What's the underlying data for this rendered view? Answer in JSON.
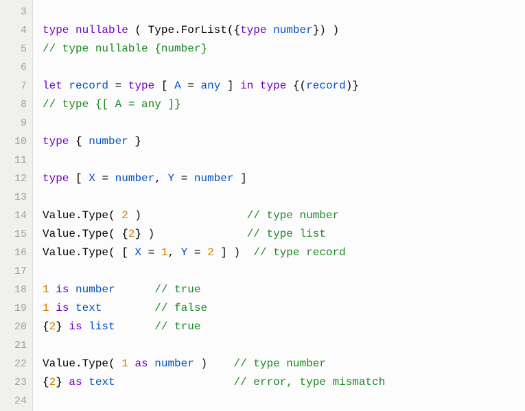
{
  "lineNumbers": [
    "3",
    "4",
    "5",
    "6",
    "7",
    "8",
    "9",
    "10",
    "11",
    "12",
    "13",
    "14",
    "15",
    "16",
    "17",
    "18",
    "19",
    "20",
    "21",
    "22",
    "23",
    "24"
  ],
  "lines": {
    "3": [],
    "4": [
      {
        "cls": "kw-type",
        "t": "type"
      },
      {
        "cls": "op",
        "t": " "
      },
      {
        "cls": "kw-type",
        "t": "nullable"
      },
      {
        "cls": "op",
        "t": " ( "
      },
      {
        "cls": "func",
        "t": "Type.ForList"
      },
      {
        "cls": "op",
        "t": "({"
      },
      {
        "cls": "kw-type",
        "t": "type"
      },
      {
        "cls": "op",
        "t": " "
      },
      {
        "cls": "kw-id",
        "t": "number"
      },
      {
        "cls": "op",
        "t": "}) )"
      }
    ],
    "5": [
      {
        "cls": "comment",
        "t": "// type nullable {number}"
      }
    ],
    "6": [],
    "7": [
      {
        "cls": "kw-type",
        "t": "let"
      },
      {
        "cls": "op",
        "t": " "
      },
      {
        "cls": "kw-id",
        "t": "record"
      },
      {
        "cls": "op",
        "t": " = "
      },
      {
        "cls": "kw-type",
        "t": "type"
      },
      {
        "cls": "op",
        "t": " [ "
      },
      {
        "cls": "kw-id",
        "t": "A"
      },
      {
        "cls": "op",
        "t": " = "
      },
      {
        "cls": "kw-id",
        "t": "any"
      },
      {
        "cls": "op",
        "t": " ] "
      },
      {
        "cls": "kw-type",
        "t": "in"
      },
      {
        "cls": "op",
        "t": " "
      },
      {
        "cls": "kw-type",
        "t": "type"
      },
      {
        "cls": "op",
        "t": " {("
      },
      {
        "cls": "kw-id",
        "t": "record"
      },
      {
        "cls": "op",
        "t": ")}"
      }
    ],
    "8": [
      {
        "cls": "comment",
        "t": "// type {[ A = any ]}"
      }
    ],
    "9": [],
    "10": [
      {
        "cls": "kw-type",
        "t": "type"
      },
      {
        "cls": "op",
        "t": " { "
      },
      {
        "cls": "kw-id",
        "t": "number"
      },
      {
        "cls": "op",
        "t": " }"
      }
    ],
    "11": [],
    "12": [
      {
        "cls": "kw-type",
        "t": "type"
      },
      {
        "cls": "op",
        "t": " [ "
      },
      {
        "cls": "kw-id",
        "t": "X"
      },
      {
        "cls": "op",
        "t": " = "
      },
      {
        "cls": "kw-id",
        "t": "number"
      },
      {
        "cls": "op",
        "t": ", "
      },
      {
        "cls": "kw-id",
        "t": "Y"
      },
      {
        "cls": "op",
        "t": " = "
      },
      {
        "cls": "kw-id",
        "t": "number"
      },
      {
        "cls": "op",
        "t": " ]"
      }
    ],
    "13": [],
    "14": [
      {
        "cls": "func",
        "t": "Value.Type"
      },
      {
        "cls": "op",
        "t": "( "
      },
      {
        "cls": "num",
        "t": "2"
      },
      {
        "cls": "op",
        "t": " )                "
      },
      {
        "cls": "comment",
        "t": "// type number"
      }
    ],
    "15": [
      {
        "cls": "func",
        "t": "Value.Type"
      },
      {
        "cls": "op",
        "t": "( {"
      },
      {
        "cls": "num",
        "t": "2"
      },
      {
        "cls": "op",
        "t": "} )              "
      },
      {
        "cls": "comment",
        "t": "// type list"
      }
    ],
    "16": [
      {
        "cls": "func",
        "t": "Value.Type"
      },
      {
        "cls": "op",
        "t": "( [ "
      },
      {
        "cls": "kw-id",
        "t": "X"
      },
      {
        "cls": "op",
        "t": " = "
      },
      {
        "cls": "num",
        "t": "1"
      },
      {
        "cls": "op",
        "t": ", "
      },
      {
        "cls": "kw-id",
        "t": "Y"
      },
      {
        "cls": "op",
        "t": " = "
      },
      {
        "cls": "num",
        "t": "2"
      },
      {
        "cls": "op",
        "t": " ] )  "
      },
      {
        "cls": "comment",
        "t": "// type record"
      }
    ],
    "17": [],
    "18": [
      {
        "cls": "num",
        "t": "1"
      },
      {
        "cls": "op",
        "t": " "
      },
      {
        "cls": "kw-type",
        "t": "is"
      },
      {
        "cls": "op",
        "t": " "
      },
      {
        "cls": "kw-id",
        "t": "number"
      },
      {
        "cls": "op",
        "t": "      "
      },
      {
        "cls": "comment",
        "t": "// true"
      }
    ],
    "19": [
      {
        "cls": "num",
        "t": "1"
      },
      {
        "cls": "op",
        "t": " "
      },
      {
        "cls": "kw-type",
        "t": "is"
      },
      {
        "cls": "op",
        "t": " "
      },
      {
        "cls": "kw-id",
        "t": "text"
      },
      {
        "cls": "op",
        "t": "        "
      },
      {
        "cls": "comment",
        "t": "// false"
      }
    ],
    "20": [
      {
        "cls": "op",
        "t": "{"
      },
      {
        "cls": "num",
        "t": "2"
      },
      {
        "cls": "op",
        "t": "} "
      },
      {
        "cls": "kw-type",
        "t": "is"
      },
      {
        "cls": "op",
        "t": " "
      },
      {
        "cls": "kw-id",
        "t": "list"
      },
      {
        "cls": "op",
        "t": "      "
      },
      {
        "cls": "comment",
        "t": "// true"
      }
    ],
    "21": [],
    "22": [
      {
        "cls": "func",
        "t": "Value.Type"
      },
      {
        "cls": "op",
        "t": "( "
      },
      {
        "cls": "num",
        "t": "1"
      },
      {
        "cls": "op",
        "t": " "
      },
      {
        "cls": "kw-type",
        "t": "as"
      },
      {
        "cls": "op",
        "t": " "
      },
      {
        "cls": "kw-id",
        "t": "number"
      },
      {
        "cls": "op",
        "t": " )    "
      },
      {
        "cls": "comment",
        "t": "// type number"
      }
    ],
    "23": [
      {
        "cls": "op",
        "t": "{"
      },
      {
        "cls": "num",
        "t": "2"
      },
      {
        "cls": "op",
        "t": "} "
      },
      {
        "cls": "kw-type",
        "t": "as"
      },
      {
        "cls": "op",
        "t": " "
      },
      {
        "cls": "kw-id",
        "t": "text"
      },
      {
        "cls": "op",
        "t": "                  "
      },
      {
        "cls": "comment",
        "t": "// error, type mismatch"
      }
    ],
    "24": []
  }
}
